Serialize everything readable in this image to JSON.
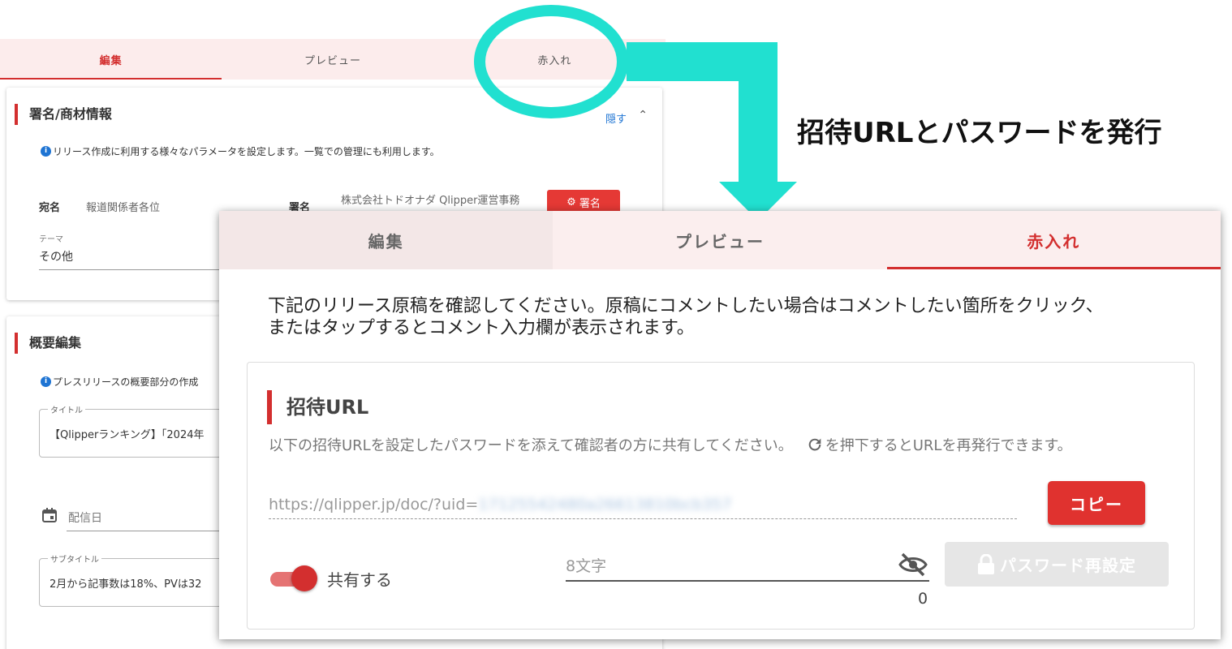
{
  "background": {
    "tabs": [
      {
        "label": "編集",
        "active": true
      },
      {
        "label": "プレビュー",
        "active": false
      },
      {
        "label": "赤入れ",
        "active": false
      }
    ],
    "section1": {
      "title": "署名/商材情報",
      "hide_link": "隠す",
      "info": "リリース作成に利用する様々なパラメータを設定します。一覧での管理にも利用します。",
      "recipient_label": "宛名",
      "recipient_value": "報道関係者各位",
      "signature_label": "署名",
      "signature_value": "株式会社トドオナダ Qlipper運営事務",
      "signature_button": "署名",
      "theme_label": "テーマ",
      "theme_value": "その他"
    },
    "section2": {
      "title": "概要編集",
      "info": "プレスリリースの概要部分の作成",
      "title_label": "タイトル",
      "title_value": "【Qlipperランキング】「2024年",
      "date_placeholder": "配信日",
      "subtitle_label": "サブタイトル",
      "subtitle_value": "2月から記事数は18%、PVは32"
    }
  },
  "annotation": {
    "headline": "招待URLとパスワードを発行",
    "ring_color": "#21e0d0"
  },
  "panel": {
    "tabs": [
      {
        "label": "編集",
        "active": false
      },
      {
        "label": "プレビュー",
        "active": false
      },
      {
        "label": "赤入れ",
        "active": true
      }
    ],
    "instruction_line1": "下記のリリース原稿を確認してください。原稿にコメントしたい場合はコメントしたい箇所をクリック、",
    "instruction_line2": "またはタップするとコメント入力欄が表示されます。",
    "invite": {
      "title": "招待URL",
      "desc_before": "以下の招待URLを設定したパスワードを添えて確認者の方に共有してください。",
      "desc_after": "を押下するとURLを再発行できます。",
      "url_prefix": "https://qlipper.jp/doc/?uid=",
      "url_token_masked": "17125542480a26613810bcb357",
      "copy_button": "コピー",
      "share_toggle_label": "共有する",
      "share_enabled": true,
      "password_placeholder": "8文字",
      "password_length": "0",
      "reset_button": "パスワード再設定"
    },
    "accent_color": "#d32f2f"
  }
}
